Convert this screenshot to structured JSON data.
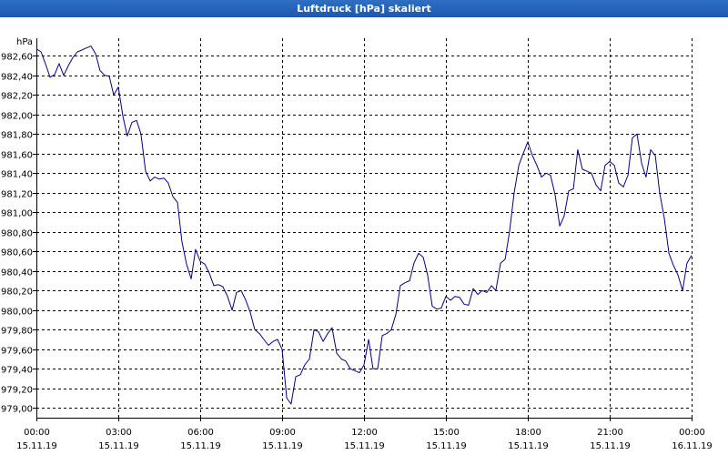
{
  "window": {
    "title": "Luftdruck [hPa] skaliert"
  },
  "chart_data": {
    "type": "line",
    "title": "Luftdruck [hPa] skaliert",
    "ylabel": "hPa",
    "xlabel": "",
    "ylim": [
      978.9,
      982.78
    ],
    "xlim": [
      0,
      24
    ],
    "grid": true,
    "y_ticks": [
      982.6,
      982.4,
      982.2,
      982.0,
      981.8,
      981.6,
      981.4,
      981.2,
      981.0,
      980.8,
      980.6,
      980.4,
      980.2,
      980.0,
      979.8,
      979.6,
      979.4,
      979.2,
      979.0
    ],
    "y_tick_labels": [
      "982,60",
      "982,40",
      "982,20",
      "982,00",
      "981,80",
      "981,60",
      "981,40",
      "981,20",
      "981,00",
      "980,80",
      "980,60",
      "980,40",
      "980,20",
      "980,00",
      "979,80",
      "979,60",
      "979,40",
      "979,20",
      "979,00"
    ],
    "x_ticks": [
      {
        "time": "00:00",
        "date": "15.11.19"
      },
      {
        "time": "03:00",
        "date": "15.11.19"
      },
      {
        "time": "06:00",
        "date": "15.11.19"
      },
      {
        "time": "09:00",
        "date": "15.11.19"
      },
      {
        "time": "12:00",
        "date": "15.11.19"
      },
      {
        "time": "15:00",
        "date": "15.11.19"
      },
      {
        "time": "18:00",
        "date": "15.11.19"
      },
      {
        "time": "21:00",
        "date": "15.11.19"
      },
      {
        "time": "00:00",
        "date": "16.11.19"
      }
    ],
    "line_color": "#00008b",
    "series": [
      {
        "x": [
          0.0,
          0.17,
          0.33,
          0.5,
          0.67,
          0.83,
          1.0,
          1.17,
          1.33,
          1.5,
          1.67,
          1.83,
          2.0,
          2.17,
          2.33,
          2.5,
          2.67,
          2.83,
          3.0,
          3.17,
          3.33,
          3.5,
          3.67,
          3.83,
          4.0,
          4.17,
          4.33,
          4.5,
          4.67,
          4.83,
          5.0,
          5.17,
          5.33,
          5.5,
          5.67,
          5.83,
          6.0,
          6.17,
          6.33,
          6.5,
          6.67,
          6.83,
          7.0,
          7.17,
          7.33,
          7.5,
          7.67,
          7.83,
          8.0,
          8.17,
          8.33,
          8.5,
          8.67,
          8.83,
          9.0,
          9.17,
          9.33,
          9.5,
          9.67,
          9.83,
          10.0,
          10.17,
          10.33,
          10.5,
          10.67,
          10.83,
          11.0,
          11.17,
          11.33,
          11.5,
          11.67,
          11.83,
          12.0,
          12.17,
          12.33,
          12.5,
          12.67,
          12.83,
          13.0,
          13.17,
          13.33,
          13.5,
          13.67,
          13.83,
          14.0,
          14.17,
          14.33,
          14.5,
          14.67,
          14.83,
          15.0,
          15.17,
          15.33,
          15.5,
          15.67,
          15.83,
          16.0,
          16.17,
          16.33,
          16.5,
          16.67,
          16.83,
          17.0,
          17.17,
          17.33,
          17.5,
          17.67,
          17.83,
          18.0,
          18.17,
          18.33,
          18.5,
          18.67,
          18.83,
          19.0,
          19.17,
          19.33,
          19.5,
          19.67,
          19.83,
          20.0,
          20.17,
          20.33,
          20.5,
          20.67,
          20.83,
          21.0,
          21.17,
          21.33,
          21.5,
          21.67,
          21.83,
          22.0,
          22.17,
          22.33,
          22.5,
          22.67,
          22.83,
          23.0,
          23.17,
          23.33,
          23.5,
          23.67,
          23.83,
          24.0
        ],
        "y": [
          982.67,
          982.64,
          982.52,
          982.38,
          982.41,
          982.52,
          982.4,
          982.5,
          982.58,
          982.64,
          982.66,
          982.68,
          982.7,
          982.62,
          982.45,
          982.4,
          982.39,
          982.2,
          982.28,
          981.98,
          981.78,
          981.92,
          981.94,
          981.8,
          981.42,
          981.32,
          981.36,
          981.34,
          981.35,
          981.3,
          981.16,
          981.1,
          980.7,
          980.47,
          980.32,
          980.62,
          980.5,
          980.47,
          980.38,
          980.25,
          980.26,
          980.24,
          980.14,
          980.0,
          980.18,
          980.2,
          980.1,
          979.98,
          979.8,
          979.76,
          979.7,
          979.64,
          979.68,
          979.7,
          979.6,
          979.1,
          979.04,
          979.32,
          979.34,
          979.44,
          979.5,
          979.8,
          979.78,
          979.68,
          979.76,
          979.82,
          979.56,
          979.5,
          979.48,
          979.4,
          979.38,
          979.36,
          979.44,
          979.7,
          979.4,
          979.4,
          979.74,
          979.76,
          979.8,
          979.96,
          980.25,
          980.28,
          980.3,
          980.48,
          980.58,
          980.54,
          980.36,
          980.04,
          980.01,
          980.02,
          980.14,
          980.1,
          980.14,
          980.13,
          980.06,
          980.05,
          980.22,
          980.16,
          980.2,
          980.18,
          980.25,
          980.2,
          980.48,
          980.52,
          980.8,
          981.2,
          981.48,
          981.6,
          981.72,
          981.58,
          981.48,
          981.36,
          981.4,
          981.38,
          981.18,
          980.86,
          980.96,
          981.22,
          981.24,
          981.64,
          981.44,
          981.42,
          981.4,
          981.28,
          981.22,
          981.48,
          981.52,
          981.48,
          981.3,
          981.26,
          981.38,
          981.76,
          981.8,
          981.5,
          981.36,
          981.64,
          981.58,
          981.2,
          980.94,
          980.58,
          980.46,
          980.36,
          980.2,
          980.48,
          980.56
        ]
      }
    ]
  }
}
